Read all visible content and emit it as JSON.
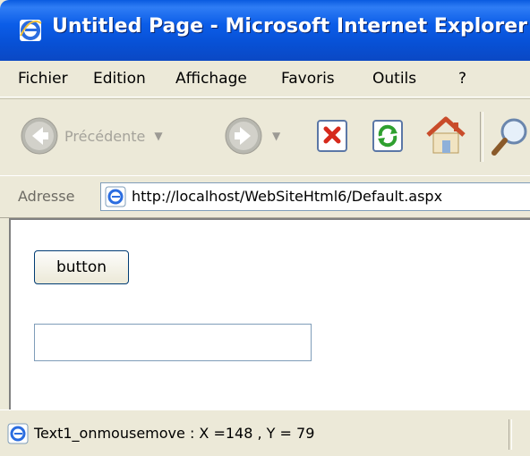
{
  "window": {
    "title": "Untitled Page - Microsoft Internet Explorer",
    "icon": "ie-icon"
  },
  "menubar": {
    "items": [
      {
        "label": "Fichier"
      },
      {
        "label": "Edition"
      },
      {
        "label": "Affichage"
      },
      {
        "label": "Favoris"
      },
      {
        "label": "Outils"
      },
      {
        "label": "?"
      }
    ]
  },
  "toolbar": {
    "back_label": "Précédente",
    "buttons": [
      "back-icon",
      "forward-icon",
      "stop-icon",
      "refresh-icon",
      "home-icon",
      "search-icon"
    ]
  },
  "address": {
    "label": "Adresse",
    "url": "http://localhost/WebSiteHtml6/Default.aspx"
  },
  "page": {
    "button_label": "button",
    "text_input_value": ""
  },
  "status": {
    "text": "Text1_onmousemove : X =148 , Y = 79"
  }
}
